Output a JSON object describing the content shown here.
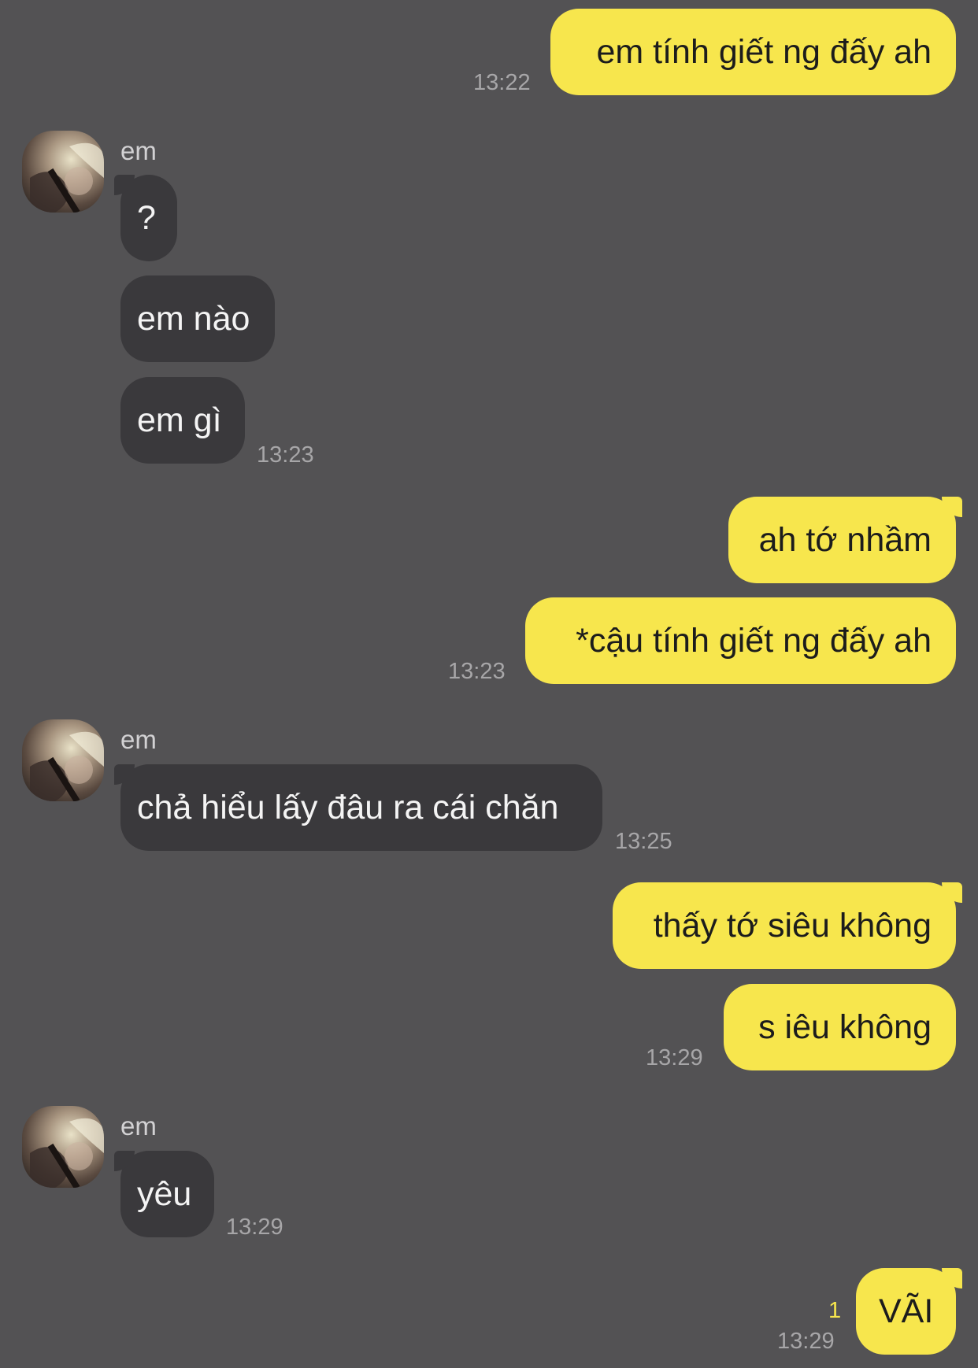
{
  "contact": {
    "name": "em"
  },
  "colors": {
    "background": "#535254",
    "outgoing_bubble": "#f7e64d",
    "incoming_bubble": "#3a393c",
    "timestamp": "#a7a6a8",
    "unread_counter": "#f7e64d"
  },
  "messages": [
    {
      "from": "me",
      "text": "em tính giết ng đấy ah",
      "time": "13:22"
    },
    {
      "from": "them",
      "sender": "em",
      "text": "?"
    },
    {
      "from": "them",
      "text": "em nào"
    },
    {
      "from": "them",
      "text": "em gì",
      "time": "13:23"
    },
    {
      "from": "me",
      "text": "ah tớ nhầm"
    },
    {
      "from": "me",
      "text": "*cậu tính giết ng đấy ah",
      "time": "13:23"
    },
    {
      "from": "them",
      "sender": "em",
      "text": "chả hiểu lấy đâu ra cái chăn",
      "time": "13:25"
    },
    {
      "from": "me",
      "text": "thấy tớ siêu không"
    },
    {
      "from": "me",
      "text": "s iêu không",
      "time": "13:29"
    },
    {
      "from": "them",
      "sender": "em",
      "text": "yêu",
      "time": "13:29"
    },
    {
      "from": "me",
      "text": "VÃI",
      "time": "13:29",
      "unread": "1"
    }
  ]
}
